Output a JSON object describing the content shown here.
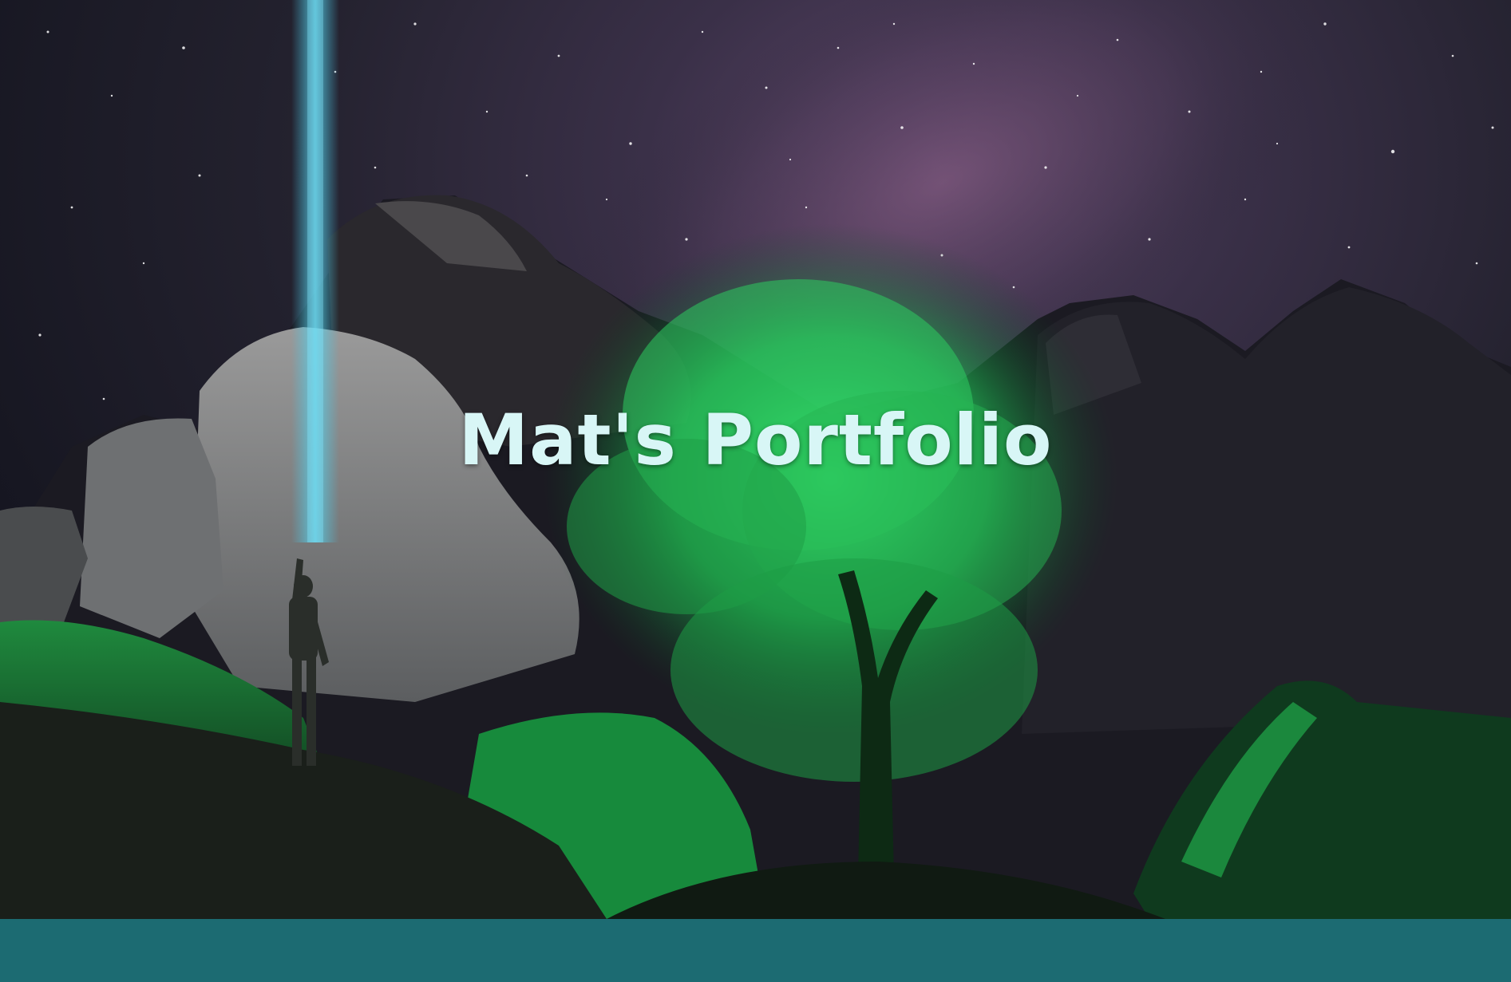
{
  "hero": {
    "title": "Mat's Portfolio"
  },
  "colors": {
    "title": "#d8f6f6",
    "footer_bar": "#1c6b72",
    "tree_glow": "#2fe06a",
    "light_beam": "#47c6e6"
  },
  "icons": {
    "background": "night-sky-photo"
  }
}
